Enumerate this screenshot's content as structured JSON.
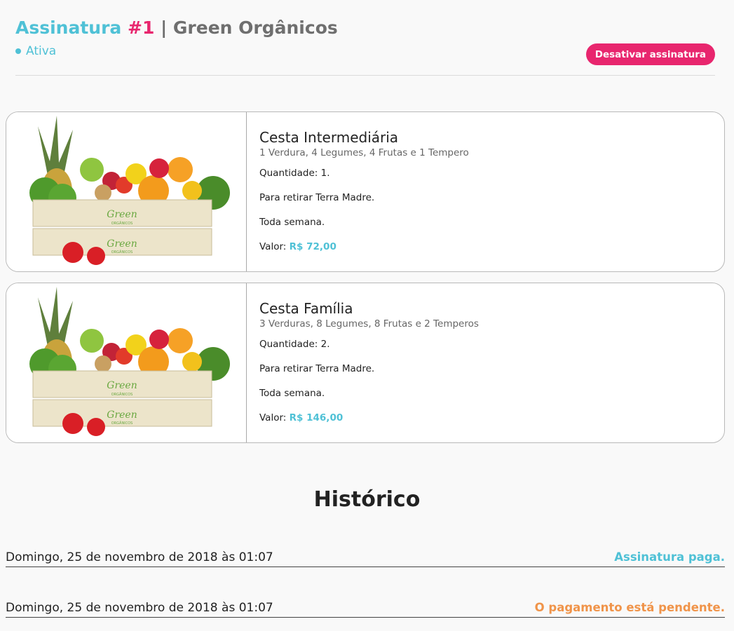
{
  "header": {
    "title_word": "Assinatura",
    "title_number": "#1",
    "title_rest": " | Green Orgânicos",
    "status": "Ativa",
    "deactivate_label": "Desativar assinatura"
  },
  "colors": {
    "accent": "#4fc1d6",
    "brand": "#e8266e",
    "pending": "#f0944a"
  },
  "products": [
    {
      "name": "Cesta Intermediária",
      "description": "1 Verdura, 4 Legumes, 4 Frutas e 1 Tempero",
      "quantity": "Quantidade: 1.",
      "pickup": "Para retirar Terra Madre.",
      "frequency": "Toda semana.",
      "price_label": "Valor:",
      "price": "R$ 72,00",
      "image": "produce-crate-image",
      "crate_brand": "Green",
      "crate_brand_sub": "ORGÂNICOS"
    },
    {
      "name": "Cesta Família",
      "description": "3 Verduras, 8 Legumes, 8 Frutas e 2 Temperos",
      "quantity": "Quantidade: 2.",
      "pickup": "Para retirar Terra Madre.",
      "frequency": "Toda semana.",
      "price_label": "Valor:",
      "price": "R$ 146,00",
      "image": "produce-crate-image",
      "crate_brand": "Green",
      "crate_brand_sub": "ORGÂNICOS"
    }
  ],
  "history": {
    "title": "Histórico",
    "entries": [
      {
        "date": "Domingo, 25 de novembro de 2018 às 01:07",
        "status": "Assinatura paga.",
        "status_color": "#4fc1d6"
      },
      {
        "date": "Domingo, 25 de novembro de 2018 às 01:07",
        "status": "O pagamento está pendente.",
        "status_color": "#f0944a"
      }
    ]
  }
}
